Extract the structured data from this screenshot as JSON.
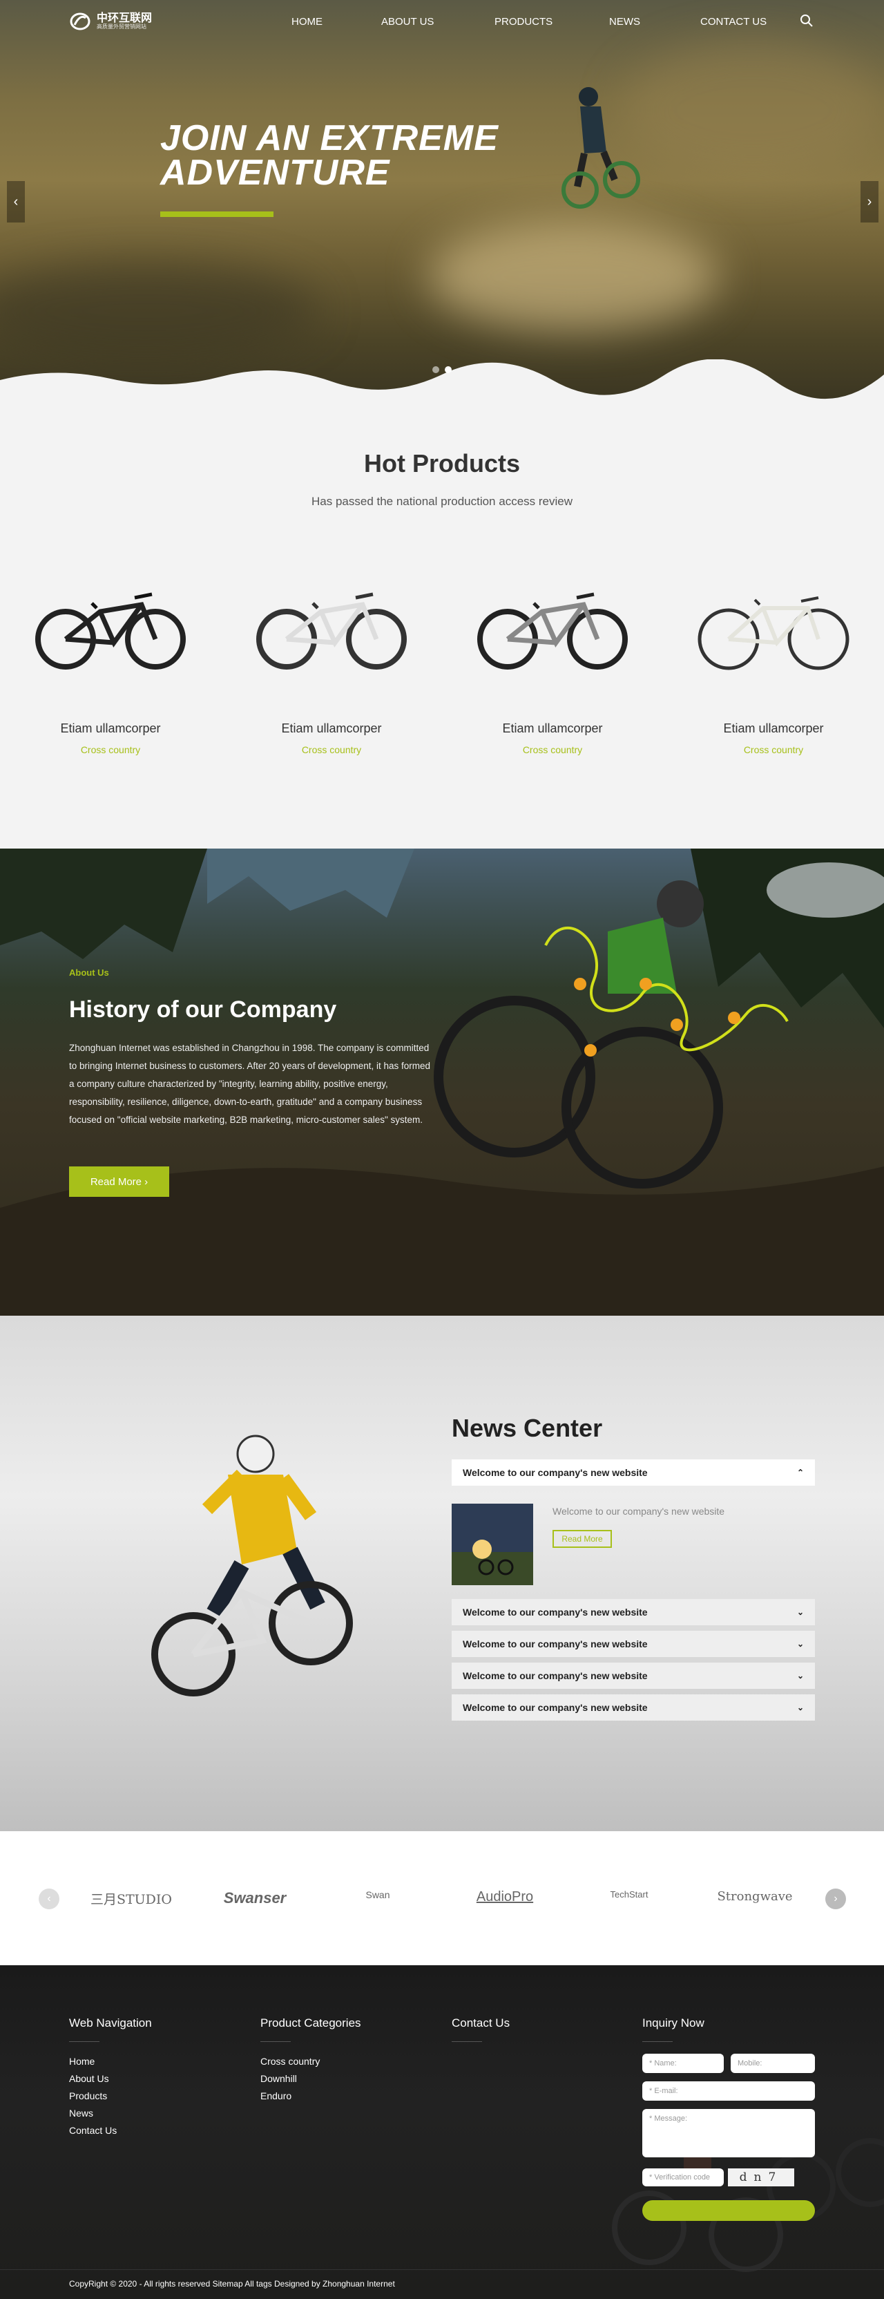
{
  "header": {
    "logo_text": "中环互联网",
    "logo_sub": "高质量外贸营销网站",
    "nav": [
      "HOME",
      "ABOUT US",
      "PRODUCTS",
      "NEWS",
      "CONTACT US"
    ]
  },
  "hero": {
    "title_line1": "JOIN AN EXTREME",
    "title_line2": "ADVENTURE",
    "prev_arrow": "‹",
    "next_arrow": "›"
  },
  "products": {
    "title": "Hot Products",
    "subtitle": "Has passed the national production access review",
    "items": [
      {
        "name": "Etiam ullamcorper",
        "category": "Cross country"
      },
      {
        "name": "Etiam ullamcorper",
        "category": "Cross country"
      },
      {
        "name": "Etiam ullamcorper",
        "category": "Cross country"
      },
      {
        "name": "Etiam ullamcorper",
        "category": "Cross country"
      }
    ]
  },
  "about": {
    "tag": "About Us",
    "title": "History of our Company",
    "text": "Zhonghuan Internet was established in Changzhou in 1998. The company is committed to bringing Internet business to customers. After 20 years of development, it has formed a company culture characterized by \"integrity, learning ability, positive energy, responsibility, resilience, diligence, down-to-earth, gratitude\" and a company business focused on \"official website marketing, B2B marketing, micro-customer sales\" system.",
    "button": "Read More ›"
  },
  "news": {
    "title": "News Center",
    "open_item": "Welcome to our company's new website",
    "excerpt": "Welcome to our company's new website",
    "read_more": "Read More",
    "items": [
      "Welcome to our company's new website",
      "Welcome to our company's new website",
      "Welcome to our company's new website",
      "Welcome to our company's new website"
    ]
  },
  "brands": [
    "三月STUDIO",
    "Swanser",
    "Swan",
    "AudioPro",
    "TechStart",
    "Strongwave"
  ],
  "footer": {
    "web_nav_title": "Web Navigation",
    "web_nav": [
      "Home",
      "About Us",
      "Products",
      "News",
      "Contact Us"
    ],
    "categories_title": "Product Categories",
    "categories": [
      "Cross country",
      "Downhill",
      "Enduro"
    ],
    "contact_title": "Contact Us",
    "inquiry_title": "Inquiry Now",
    "name_placeholder": "* Name:",
    "mobile_placeholder": "Mobile:",
    "email_placeholder": "* E-mail:",
    "message_placeholder": "* Message:",
    "verification_placeholder": "* Verification code",
    "captcha": "dn7",
    "copyright": "CopyRight © 2020 -     All rights reserved   Sitemap   All tags    Designed by Zhonghuan Internet"
  },
  "colors": {
    "accent": "#a7c01a",
    "footer_bg": "#1a1a1a"
  }
}
